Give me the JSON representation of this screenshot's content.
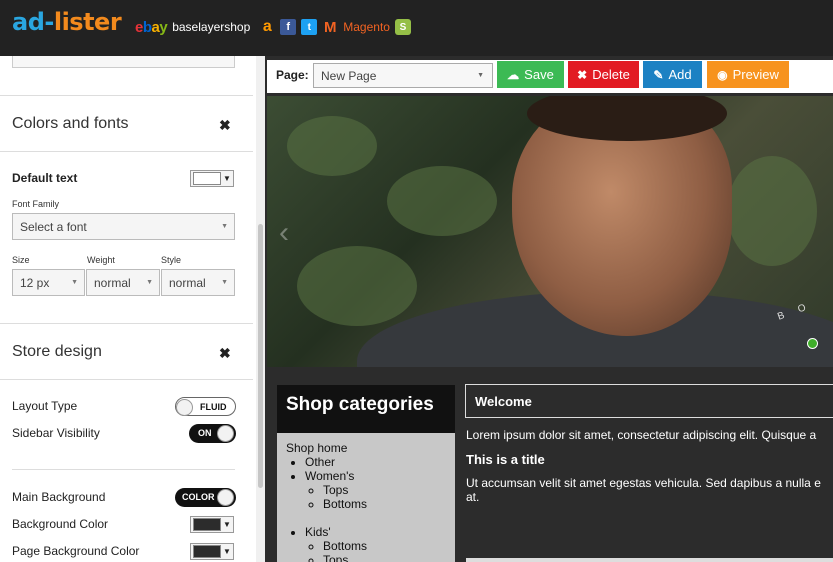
{
  "brand": {
    "logo_part1": "ad-",
    "logo_part2": "lister"
  },
  "channels": {
    "ebay": [
      "e",
      "b",
      "a",
      "y"
    ],
    "shop_name": "baselayershop",
    "magento_label": "Magento",
    "icons": [
      "ebay-logo",
      "amazon-icon",
      "facebook-icon",
      "twitter-icon",
      "magento-icon",
      "shopify-icon"
    ]
  },
  "sidebar": {
    "colors_fonts": {
      "title": "Colors and fonts",
      "default_text_label": "Default text",
      "default_text_color": "#ffffff",
      "font_family_label": "Font Family",
      "font_family_value": "Select a font",
      "size_label": "Size",
      "size_value": "12 px",
      "weight_label": "Weight",
      "weight_value": "normal",
      "style_label": "Style",
      "style_value": "normal"
    },
    "store_design": {
      "title": "Store design",
      "layout_type_label": "Layout Type",
      "layout_type_toggle": "FLUID",
      "sidebar_visibility_label": "Sidebar Visibility",
      "sidebar_visibility_toggle": "ON",
      "main_background_label": "Main Background",
      "main_background_toggle": "COLOR",
      "background_color_label": "Background Color",
      "background_color_value": "#2c2c2c",
      "page_background_color_label": "Page Background Color",
      "page_background_color_value": "#2c2c2c"
    },
    "close_glyph": "✖"
  },
  "toolbar": {
    "page_label": "Page:",
    "page_value": "New Page",
    "save_label": "Save",
    "delete_label": "Delete",
    "add_label": "Add",
    "preview_label": "Preview",
    "colors": {
      "save": "#3cba54",
      "delete": "#e21b23",
      "add": "#1c81c3",
      "preview": "#f7931e"
    }
  },
  "store": {
    "categories_title": "Shop categories",
    "shop_home": "Shop home",
    "categories": [
      {
        "label": "Other",
        "children": []
      },
      {
        "label": "Women's",
        "children": [
          "Tops",
          "Bottoms"
        ]
      },
      {
        "label": "Kids'",
        "children": [
          "Bottoms",
          "Tops"
        ]
      }
    ],
    "welcome_title": "Welcome",
    "intro_text": "Lorem ipsum dolor sit amet, consectetur adipiscing elit. Quisque a",
    "section_title": "This is a title",
    "body_line1": "Ut accumsan velit sit amet egestas vehicula. Sed dapibus a nulla e",
    "body_line2": "at.",
    "hero_brand_text": "B O"
  }
}
